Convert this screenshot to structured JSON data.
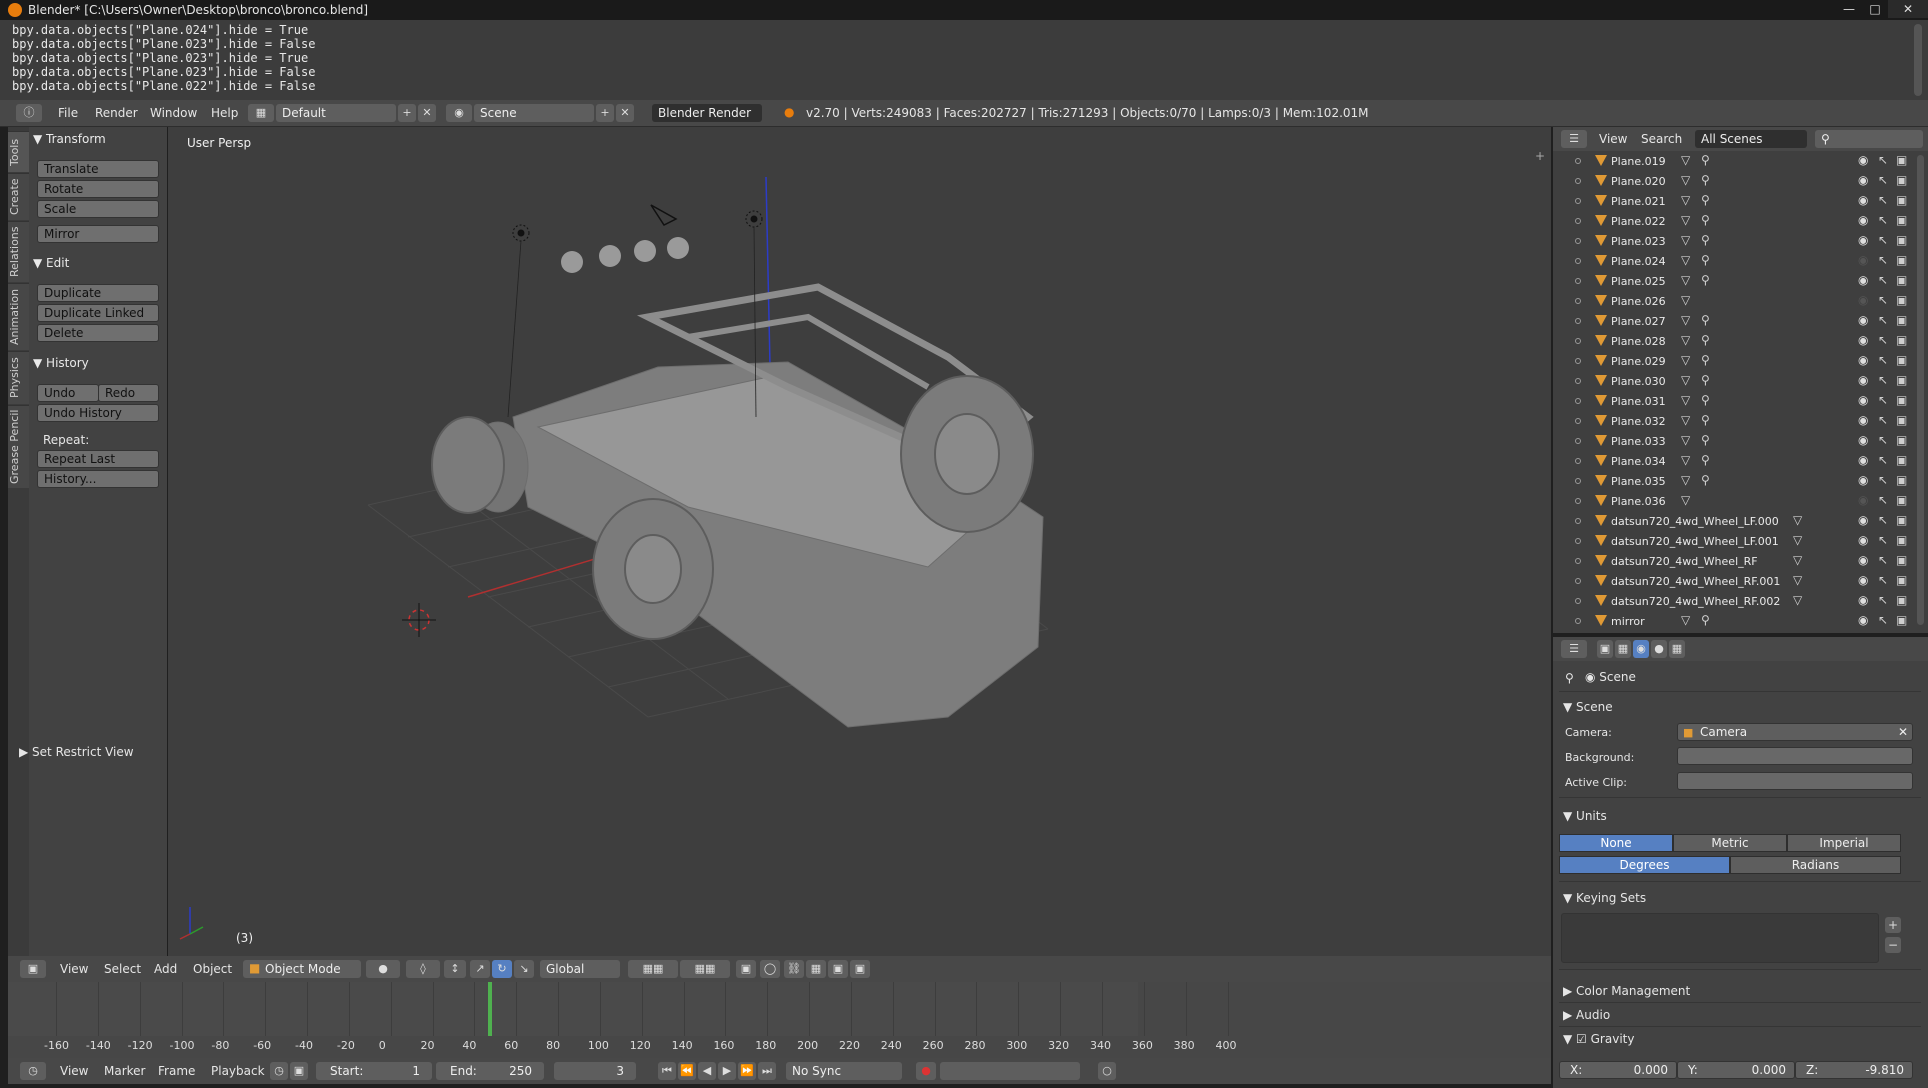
{
  "window": {
    "title": "Blender* [C:\\Users\\Owner\\Desktop\\bronco\\bronco.blend]"
  },
  "console": {
    "lines": [
      "bpy.data.objects[\"Plane.024\"].hide = True",
      "bpy.data.objects[\"Plane.023\"].hide = False",
      "bpy.data.objects[\"Plane.023\"].hide = True",
      "bpy.data.objects[\"Plane.023\"].hide = False",
      "bpy.data.objects[\"Plane.022\"].hide = False"
    ]
  },
  "info": {
    "menus": [
      "File",
      "Render",
      "Window",
      "Help"
    ],
    "layout": "Default",
    "scene": "Scene",
    "engine": "Blender Render",
    "stats": "v2.70 | Verts:249083 | Faces:202727 | Tris:271293 | Objects:0/70 | Lamps:0/3 | Mem:102.01M"
  },
  "tool_tabs": [
    "Tools",
    "Create",
    "Relations",
    "Animation",
    "Physics",
    "Grease Pencil"
  ],
  "toolshelf": {
    "transform": {
      "title": "Transform",
      "buttons": [
        "Translate",
        "Rotate",
        "Scale",
        "Mirror"
      ]
    },
    "edit": {
      "title": "Edit",
      "buttons": [
        "Duplicate",
        "Duplicate Linked",
        "Delete"
      ]
    },
    "history": {
      "title": "History",
      "undo": "Undo",
      "redo": "Redo",
      "undo_history": "Undo History",
      "repeat_label": "Repeat:",
      "repeat_last": "Repeat Last",
      "history_btn": "History..."
    },
    "restrict": "Set Restrict View"
  },
  "viewport": {
    "label": "User Persp",
    "frame_indicator": "(3)"
  },
  "view3d_header": {
    "menus": [
      "View",
      "Select",
      "Add",
      "Object"
    ],
    "mode": "Object Mode",
    "orientation": "Global"
  },
  "timeline": {
    "ticks": [
      "-160",
      "-140",
      "-120",
      "-100",
      "-80",
      "-60",
      "-40",
      "-20",
      "0",
      "20",
      "40",
      "60",
      "80",
      "100",
      "120",
      "140",
      "160",
      "180",
      "200",
      "220",
      "240",
      "260",
      "280",
      "300",
      "320",
      "340",
      "360",
      "380",
      "400"
    ],
    "menus": [
      "View",
      "Marker",
      "Frame",
      "Playback"
    ],
    "start_label": "Start:",
    "start": "1",
    "end_label": "End:",
    "end": "250",
    "current": "3",
    "sync": "No Sync"
  },
  "outliner": {
    "menus": [
      "View",
      "Search"
    ],
    "filter": "All Scenes",
    "items": [
      "Plane.019",
      "Plane.020",
      "Plane.021",
      "Plane.022",
      "Plane.023",
      "Plane.024",
      "Plane.025",
      "Plane.026",
      "Plane.027",
      "Plane.028",
      "Plane.029",
      "Plane.030",
      "Plane.031",
      "Plane.032",
      "Plane.033",
      "Plane.034",
      "Plane.035",
      "Plane.036",
      "datsun720_4wd_Wheel_LF.000",
      "datsun720_4wd_Wheel_LF.001",
      "datsun720_4wd_Wheel_RF",
      "datsun720_4wd_Wheel_RF.001",
      "datsun720_4wd_Wheel_RF.002",
      "mirror"
    ]
  },
  "properties": {
    "context": "Scene",
    "scene_panel": {
      "title": "Scene",
      "camera_label": "Camera:",
      "camera": "Camera",
      "background_label": "Background:",
      "active_clip_label": "Active Clip:"
    },
    "units_panel": {
      "title": "Units",
      "systems": [
        "None",
        "Metric",
        "Imperial"
      ],
      "rotation": [
        "Degrees",
        "Radians"
      ]
    },
    "keying_sets": "Keying Sets",
    "color_management": "Color Management",
    "audio": "Audio",
    "gravity": {
      "title": "Gravity",
      "x_label": "X:",
      "x": "0.000",
      "y_label": "Y:",
      "y": "0.000",
      "z_label": "Z:",
      "z": "-9.810"
    }
  },
  "colors": {
    "accent": "#5680c2",
    "mesh_icon": "#e09a35",
    "grid": "#4a4a4a"
  }
}
